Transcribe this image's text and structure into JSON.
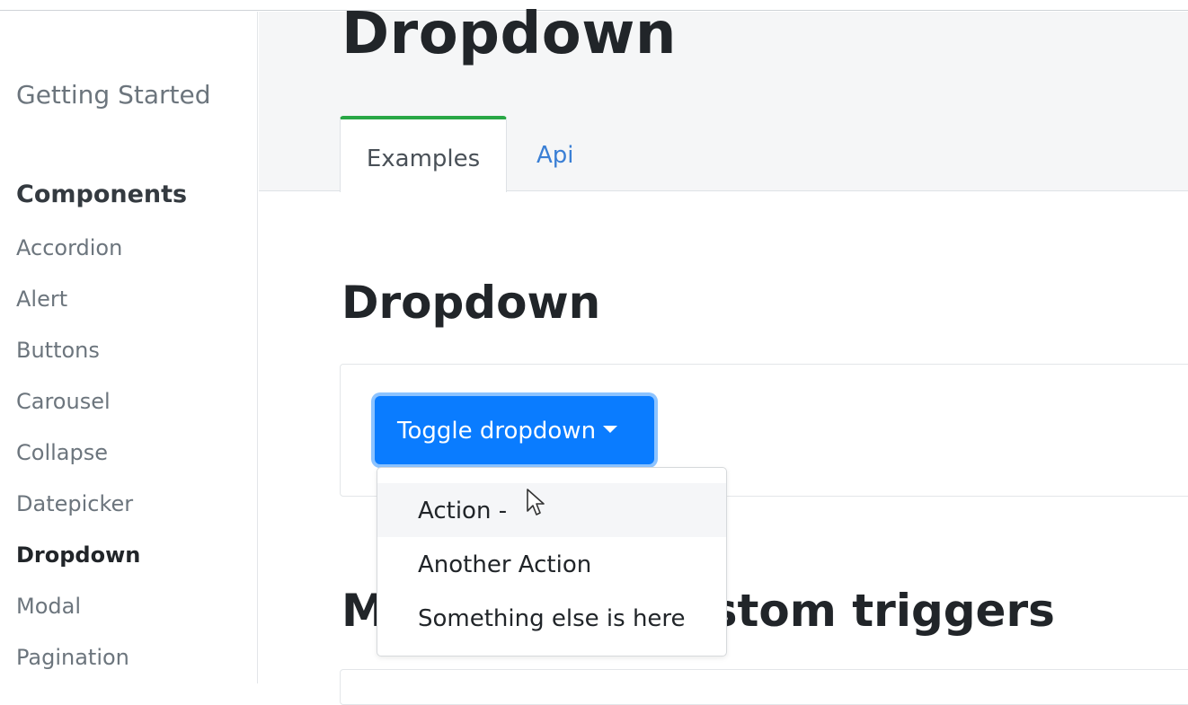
{
  "sidebar": {
    "getting_started": "Getting Started",
    "section_title": "Components",
    "items": [
      {
        "label": "Accordion"
      },
      {
        "label": "Alert"
      },
      {
        "label": "Buttons"
      },
      {
        "label": "Carousel"
      },
      {
        "label": "Collapse"
      },
      {
        "label": "Datepicker"
      },
      {
        "label": "Dropdown"
      },
      {
        "label": "Modal"
      },
      {
        "label": "Pagination"
      }
    ],
    "active_item": "Dropdown"
  },
  "header": {
    "title": "Dropdown",
    "tabs": [
      {
        "label": "Examples",
        "active": true
      },
      {
        "label": "Api",
        "active": false
      }
    ]
  },
  "main": {
    "section_heading": "Dropdown",
    "toggle_button": "Toggle dropdown",
    "dropdown_items": [
      {
        "label": "Action -"
      },
      {
        "label": "Another Action"
      },
      {
        "label": "Something else is here"
      }
    ],
    "bottom_heading": "Manual and custom triggers"
  },
  "colors": {
    "primary": "#0a7cff",
    "tab_active_accent": "#28a745",
    "link": "#3a7fd5"
  }
}
